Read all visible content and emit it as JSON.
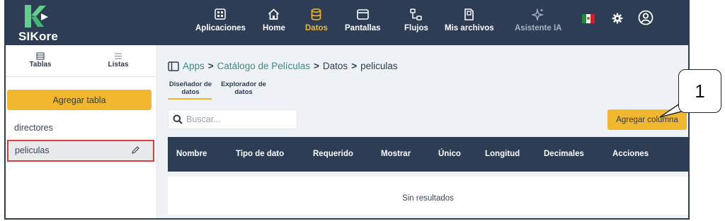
{
  "app": {
    "name": "SIKore"
  },
  "nav": [
    {
      "label": "Aplicaciones",
      "icon": "grid-icon"
    },
    {
      "label": "Home",
      "icon": "home-icon"
    },
    {
      "label": "Datos",
      "icon": "database-icon",
      "active": true
    },
    {
      "label": "Pantallas",
      "icon": "window-icon"
    },
    {
      "label": "Flujos",
      "icon": "flow-icon"
    },
    {
      "label": "Mis archivos",
      "icon": "file-icon"
    },
    {
      "label": "Asistente IA",
      "icon": "sparkle-icon"
    }
  ],
  "header_icons": [
    "mexico-flag-icon",
    "gear-icon",
    "user-icon"
  ],
  "sidebar": {
    "tabs": [
      {
        "label": "Tablas",
        "icon": "table-icon"
      },
      {
        "label": "Listas",
        "icon": "list-icon"
      }
    ],
    "add_table_label": "Agregar tabla",
    "items": [
      {
        "label": "directores"
      },
      {
        "label": "peliculas",
        "selected": true
      }
    ]
  },
  "breadcrumb": {
    "items": [
      "Apps",
      "Catálogo de Películas",
      "Datos",
      "peliculas"
    ],
    "separator": ">"
  },
  "data_tabs": [
    {
      "line1": "Diseñador de",
      "line2": "datos",
      "active": true
    },
    {
      "line1": "Explorador de",
      "line2": "datos"
    }
  ],
  "search": {
    "placeholder": "Buscar..."
  },
  "add_column_label": "Agregar columna",
  "table": {
    "columns": [
      "Nombre",
      "Tipo de dato",
      "Requerido",
      "Mostrar",
      "Único",
      "Longitud",
      "Decimales",
      "Acciones"
    ],
    "empty_text": "Sin resultados"
  },
  "callout": {
    "number": "1"
  },
  "colors": {
    "navy": "#2d3d55",
    "accent": "#f0b72f",
    "link": "#3b8a86",
    "highlight_border": "#e03a3a",
    "logo_green": "#5fd08a"
  }
}
